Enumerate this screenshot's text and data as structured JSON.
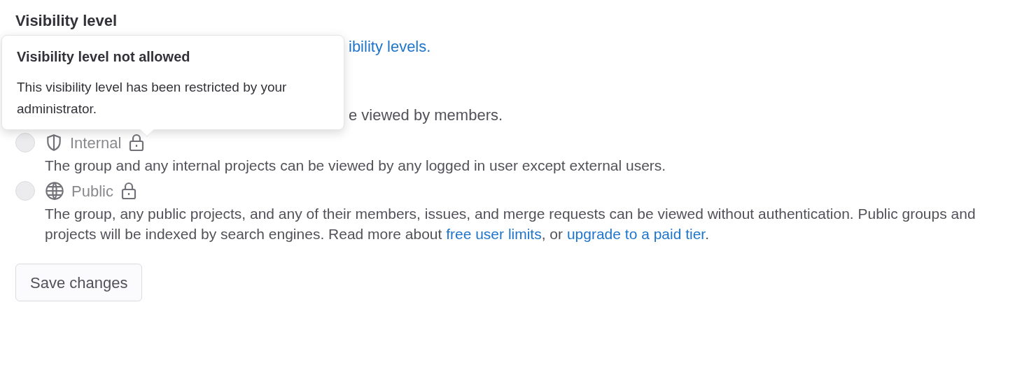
{
  "heading": "Visibility level",
  "help_link_fragment": "ibility levels.",
  "covered_option_fragment": "e viewed by members.",
  "options": [
    {
      "label": "Internal",
      "kind": "internal",
      "locked": true,
      "selected": false,
      "disabled": true,
      "description": [
        {
          "kind": "text",
          "text": "The group and any internal projects can be viewed by any logged in user except external users."
        }
      ]
    },
    {
      "label": "Public",
      "kind": "public",
      "locked": true,
      "selected": false,
      "disabled": true,
      "description": [
        {
          "kind": "text",
          "text": "The group, any public projects, and any of their members, issues, and merge requests can be viewed without authentication. Public groups and projects will be indexed by search engines. Read more about "
        },
        {
          "kind": "link",
          "text": "free user limits"
        },
        {
          "kind": "text",
          "text": ", or "
        },
        {
          "kind": "link",
          "text": "upgrade to a paid tier"
        },
        {
          "kind": "text",
          "text": "."
        }
      ]
    }
  ],
  "tooltip": {
    "title": "Visibility level not allowed",
    "body": "This visibility level has been restricted by your administrator."
  },
  "save_button": "Save changes"
}
